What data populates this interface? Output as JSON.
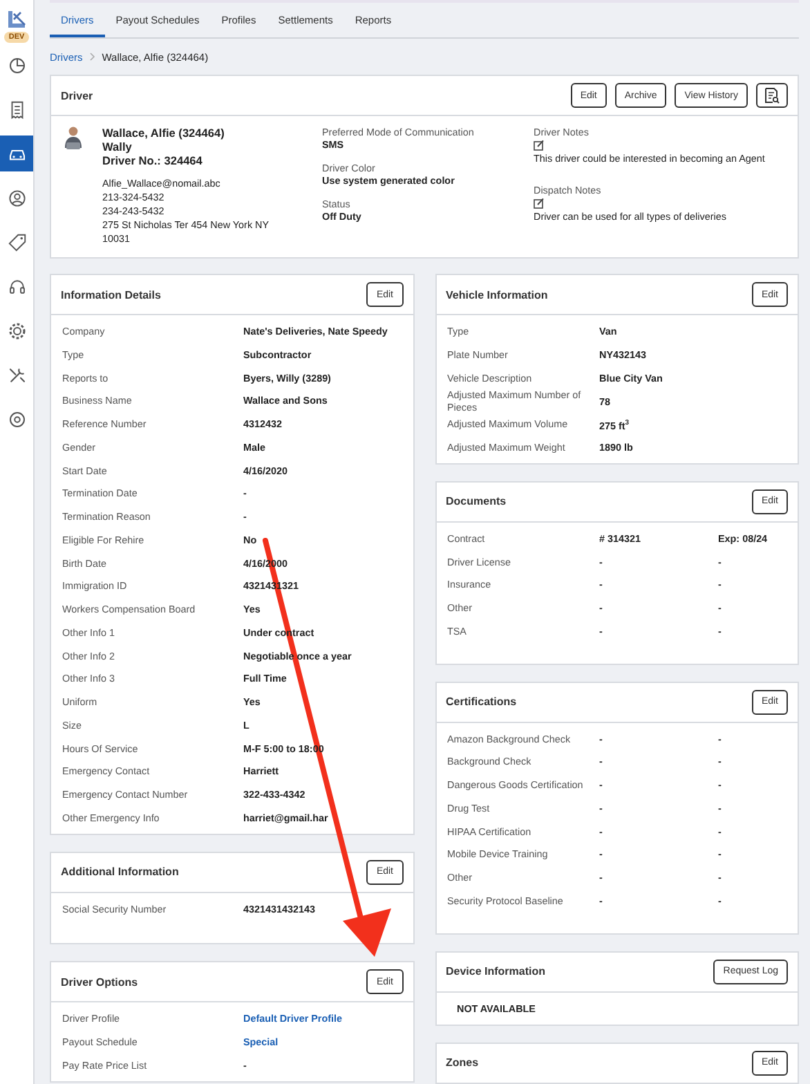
{
  "sidebar": {
    "env_badge": "DEV",
    "items": [
      {
        "kind": "pie",
        "selected": false
      },
      {
        "kind": "receipt",
        "selected": false
      },
      {
        "kind": "car",
        "selected": true
      },
      {
        "kind": "person",
        "selected": false
      },
      {
        "kind": "tag",
        "selected": false
      },
      {
        "kind": "headset",
        "selected": false
      },
      {
        "kind": "gear",
        "selected": false
      },
      {
        "kind": "tools",
        "selected": false
      },
      {
        "kind": "cog",
        "selected": false
      }
    ]
  },
  "tabs": [
    {
      "label": "Drivers",
      "selected": true
    },
    {
      "label": "Payout Schedules",
      "selected": false
    },
    {
      "label": "Profiles",
      "selected": false
    },
    {
      "label": "Settlements",
      "selected": false
    },
    {
      "label": "Reports",
      "selected": false
    }
  ],
  "breadcrumb": [
    {
      "label": "Drivers",
      "kind": "link"
    },
    {
      "label": "Wallace, Alfie (324464)",
      "kind": "current"
    }
  ],
  "driver": {
    "title": "Driver",
    "buttons": [
      {
        "kind": "text",
        "label": "Edit"
      },
      {
        "kind": "text",
        "label": "Archive"
      },
      {
        "kind": "text",
        "label": "View History"
      },
      {
        "kind": "icon"
      }
    ],
    "name": "Wallace, Alfie (324464)",
    "nickname": "Wally",
    "driver_no": "Driver No.: 324464",
    "email": "Alfie_Wallace@nomail.abc",
    "phones": [
      "213-324-5432",
      "234-243-5432"
    ],
    "address": "275 St Nicholas Ter 454 New York NY 10031",
    "fields": [
      {
        "label": "Preferred Mode of Communication",
        "value": "SMS"
      },
      {
        "label": "Driver Color",
        "value": "Use system generated color"
      },
      {
        "label": "Status",
        "value": "Off Duty"
      }
    ],
    "notes": [
      {
        "label": "Driver Notes",
        "text": "This driver could be interested in becoming an Agent"
      },
      {
        "label": "Dispatch Notes",
        "text": "Driver can be used for all types of deliveries"
      }
    ]
  },
  "left_column": [
    {
      "title": "Information Details",
      "button": "Edit",
      "rows": [
        {
          "label": "Company",
          "values": [
            "Nate's Deliveries, Nate Speedy"
          ]
        },
        {
          "label": "Type",
          "values": [
            "Subcontractor"
          ]
        },
        {
          "label": "Reports to",
          "values": [
            "Byers, Willy (3289)"
          ]
        },
        {
          "label": "Business Name",
          "values": [
            "Wallace and Sons"
          ]
        },
        {
          "label": "Reference Number",
          "values": [
            "4312432"
          ]
        },
        {
          "label": "Gender",
          "values": [
            "Male"
          ]
        },
        {
          "label": "Start Date",
          "values": [
            "4/16/2020"
          ]
        },
        {
          "label": "Termination Date",
          "values": [
            "-"
          ]
        },
        {
          "label": "Termination Reason",
          "values": [
            "-"
          ]
        },
        {
          "label": "Eligible For Rehire",
          "values": [
            "No"
          ]
        },
        {
          "label": "Birth Date",
          "values": [
            "4/16/2000"
          ]
        },
        {
          "label": "Immigration ID",
          "values": [
            "4321431321"
          ]
        },
        {
          "label": "Workers Compensation Board",
          "values": [
            "Yes"
          ]
        },
        {
          "label": "Other Info 1",
          "values": [
            "Under contract"
          ]
        },
        {
          "label": "Other Info 2",
          "values": [
            "Negotiable once a year"
          ]
        },
        {
          "label": "Other Info 3",
          "values": [
            "Full Time"
          ]
        },
        {
          "label": "Uniform",
          "values": [
            "Yes"
          ]
        },
        {
          "label": "Size",
          "values": [
            "L"
          ]
        },
        {
          "label": "Hours Of Service",
          "values": [
            "M-F 5:00 to 18:00"
          ]
        },
        {
          "label": "Emergency Contact",
          "values": [
            "Harriett"
          ]
        },
        {
          "label": "Emergency Contact Number",
          "values": [
            "322-433-4342"
          ]
        },
        {
          "label": "Other Emergency Info",
          "values": [
            "harriet@gmail.har"
          ]
        }
      ]
    },
    {
      "title": "Additional Information",
      "button": "Edit",
      "rows": [
        {
          "label": "Social Security Number",
          "values": [
            "4321431432143"
          ]
        }
      ]
    },
    {
      "title": "Driver Options",
      "button": "Edit",
      "rows": [
        {
          "label": "Driver Profile",
          "kind": "link",
          "values": [
            "Default Driver Profile"
          ]
        },
        {
          "label": "Payout Schedule",
          "kind": "link",
          "values": [
            "Special"
          ]
        },
        {
          "label": "Pay Rate Price List",
          "kind": "text",
          "values": [
            "-"
          ]
        }
      ]
    }
  ],
  "right_column": [
    {
      "title": "Vehicle Information",
      "button": "Edit",
      "rows": [
        {
          "label": "Type",
          "values": [
            "Van"
          ]
        },
        {
          "label": "Plate Number",
          "values": [
            "NY432143"
          ]
        },
        {
          "label": "Vehicle Description",
          "values": [
            "Blue City Van"
          ]
        },
        {
          "label": "Adjusted Maximum Number of Pieces",
          "values": [
            "78"
          ]
        },
        {
          "label": "Adjusted Maximum Volume",
          "values": [
            "275 ft$^{3}$"
          ]
        },
        {
          "label": "Adjusted Maximum Weight",
          "values": [
            "1890 lb"
          ]
        }
      ]
    },
    {
      "title": "Documents",
      "button": "Edit",
      "rows": [
        {
          "label": "Contract",
          "values": [
            "# 314321",
            "Exp: 08/24"
          ]
        },
        {
          "label": "Driver License",
          "values": [
            "-",
            "-"
          ]
        },
        {
          "label": "Insurance",
          "values": [
            "-",
            "-"
          ]
        },
        {
          "label": "Other",
          "values": [
            "-",
            "-"
          ]
        },
        {
          "label": "TSA",
          "values": [
            "-",
            "-"
          ]
        }
      ]
    },
    {
      "title": "Certifications",
      "button": "Edit",
      "rows": [
        {
          "label": "Amazon Background Check",
          "values": [
            "-",
            "-"
          ]
        },
        {
          "label": "Background Check",
          "values": [
            "-",
            "-"
          ]
        },
        {
          "label": "Dangerous Goods Certification",
          "values": [
            "-",
            "-"
          ]
        },
        {
          "label": "Drug Test",
          "values": [
            "-",
            "-"
          ]
        },
        {
          "label": "HIPAA Certification",
          "values": [
            "-",
            "-"
          ]
        },
        {
          "label": "Mobile Device Training",
          "values": [
            "-",
            "-"
          ]
        },
        {
          "label": "Other",
          "values": [
            "-",
            "-"
          ]
        },
        {
          "label": "Security Protocol Baseline",
          "values": [
            "-",
            "-"
          ]
        }
      ]
    },
    {
      "title": "Device Information",
      "button": "Request Log",
      "message": "NOT AVAILABLE"
    },
    {
      "title": "Zones",
      "button": "Edit"
    }
  ]
}
